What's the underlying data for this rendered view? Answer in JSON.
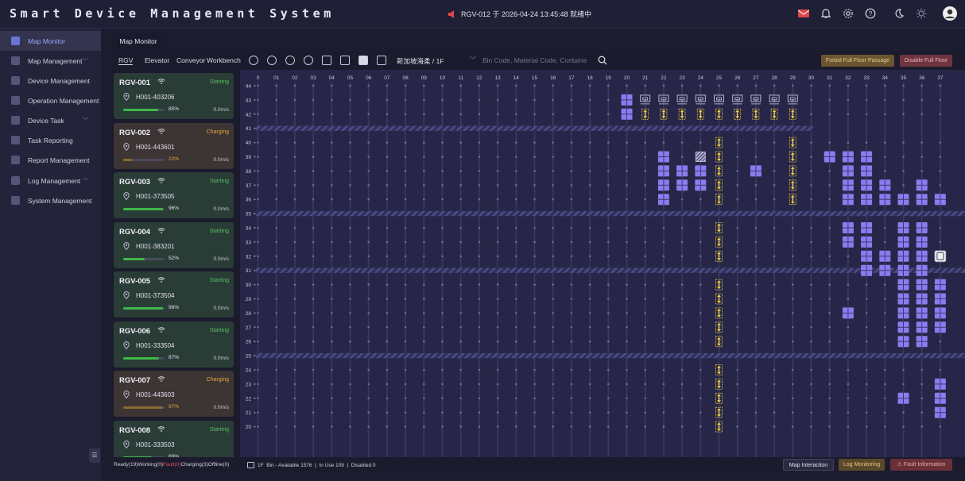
{
  "app": {
    "title": "Smart Device Management System",
    "alert_text": "RGV-012 于 2026-04-24 13:45:48 就绪中",
    "top_icons": [
      "mail-icon",
      "bell-icon",
      "gear-icon",
      "help-icon",
      "moon-icon",
      "sun-icon",
      "avatar"
    ]
  },
  "sidebar": {
    "items": [
      {
        "label": "Map Monitor",
        "active": true,
        "chevron": false
      },
      {
        "label": "Map Management",
        "active": false,
        "chevron": true
      },
      {
        "label": "Device Management",
        "active": false,
        "chevron": false
      },
      {
        "label": "Operation Management",
        "active": false,
        "chevron": false
      },
      {
        "label": "Device Task",
        "active": false,
        "chevron": true
      },
      {
        "label": "Task Reporting",
        "active": false,
        "chevron": false
      },
      {
        "label": "Report Management",
        "active": false,
        "chevron": false
      },
      {
        "label": "Log Management",
        "active": false,
        "chevron": true
      },
      {
        "label": "System Management",
        "active": false,
        "chevron": false
      }
    ],
    "collapse_glyph": "☰"
  },
  "tabs": {
    "active": "Map Monitor"
  },
  "toolbar": {
    "tabs": [
      "RGV",
      "Elevator",
      "Conveyor",
      "Workbench"
    ],
    "floor": "新加坡海柔 / 1F",
    "search_placeholder": "Bin Code, Material Code, Containe",
    "forbid_label": "Forbid Full Floor Passage",
    "disable_label": "Disable Full Floor"
  },
  "devices": [
    {
      "name": "RGV-001",
      "status": "Starting",
      "code": "H001-403206",
      "battery": 85,
      "battery_label": "85%",
      "speed": "0.0m/s"
    },
    {
      "name": "RGV-002",
      "status": "Charging",
      "code": "H001-443601",
      "battery": 22,
      "battery_label": "22%",
      "speed": "0.0m/s"
    },
    {
      "name": "RGV-003",
      "status": "Starting",
      "code": "H001-373505",
      "battery": 96,
      "battery_label": "96%",
      "speed": "0.0m/s"
    },
    {
      "name": "RGV-004",
      "status": "Starting",
      "code": "H001-383201",
      "battery": 52,
      "battery_label": "52%",
      "speed": "0.0m/s"
    },
    {
      "name": "RGV-005",
      "status": "Starting",
      "code": "H001-373504",
      "battery": 96,
      "battery_label": "96%",
      "speed": "0.0m/s"
    },
    {
      "name": "RGV-006",
      "status": "Starting",
      "code": "H001-333504",
      "battery": 87,
      "battery_label": "87%",
      "speed": "0.0m/s"
    },
    {
      "name": "RGV-007",
      "status": "Charging",
      "code": "H001-443603",
      "battery": 97,
      "battery_label": "97%",
      "speed": "0.0m/s"
    },
    {
      "name": "RGV-008",
      "status": "Starting",
      "code": "H001-333503",
      "battery": 69,
      "battery_label": "69%",
      "speed": ""
    }
  ],
  "map": {
    "col_labels": [
      "0",
      "01",
      "02",
      "03",
      "04",
      "05",
      "06",
      "07",
      "08",
      "09",
      "10",
      "11",
      "12",
      "13",
      "14",
      "15",
      "16",
      "17",
      "18",
      "19",
      "20",
      "21",
      "22",
      "23",
      "24",
      "25",
      "26",
      "27",
      "28",
      "29",
      "30",
      "31",
      "32",
      "33",
      "34",
      "35",
      "36",
      "37"
    ],
    "row_labels": [
      "44",
      "43",
      "42",
      "41",
      "40",
      "39",
      "38",
      "37",
      "36",
      "35",
      "34",
      "33",
      "32",
      "31",
      "30",
      "29",
      "28",
      "27",
      "26",
      "25",
      "24",
      "23",
      "22",
      "21",
      "20"
    ],
    "aisle_rows": [
      "41",
      "35",
      "31",
      "25"
    ],
    "aisle_extent_cols": [
      "0",
      "30"
    ],
    "bins": [
      [
        "20",
        "43"
      ],
      [
        "20",
        "42"
      ],
      [
        "22",
        "39"
      ],
      [
        "22",
        "38"
      ],
      [
        "22",
        "37"
      ],
      [
        "22",
        "36"
      ],
      [
        "23",
        "38"
      ],
      [
        "23",
        "37"
      ],
      [
        "24",
        "38"
      ],
      [
        "24",
        "37"
      ],
      [
        "27",
        "38"
      ],
      [
        "31",
        "39"
      ],
      [
        "32",
        "39"
      ],
      [
        "32",
        "38"
      ],
      [
        "32",
        "37"
      ],
      [
        "32",
        "36"
      ],
      [
        "32",
        "34"
      ],
      [
        "32",
        "33"
      ],
      [
        "32",
        "28"
      ],
      [
        "33",
        "39"
      ],
      [
        "33",
        "38"
      ],
      [
        "33",
        "37"
      ],
      [
        "33",
        "36"
      ],
      [
        "33",
        "34"
      ],
      [
        "33",
        "33"
      ],
      [
        "33",
        "32"
      ],
      [
        "33",
        "31"
      ],
      [
        "34",
        "37"
      ],
      [
        "34",
        "36"
      ],
      [
        "34",
        "32"
      ],
      [
        "34",
        "31"
      ],
      [
        "35",
        "36"
      ],
      [
        "35",
        "34"
      ],
      [
        "35",
        "33"
      ],
      [
        "35",
        "32"
      ],
      [
        "35",
        "31"
      ],
      [
        "35",
        "30"
      ],
      [
        "35",
        "29"
      ],
      [
        "35",
        "28"
      ],
      [
        "35",
        "27"
      ],
      [
        "35",
        "26"
      ],
      [
        "35",
        "22"
      ],
      [
        "36",
        "37"
      ],
      [
        "36",
        "36"
      ],
      [
        "36",
        "34"
      ],
      [
        "36",
        "33"
      ],
      [
        "36",
        "32"
      ],
      [
        "36",
        "31"
      ],
      [
        "36",
        "30"
      ],
      [
        "36",
        "29"
      ],
      [
        "36",
        "28"
      ],
      [
        "36",
        "27"
      ],
      [
        "36",
        "26"
      ],
      [
        "37",
        "36"
      ],
      [
        "37",
        "30"
      ],
      [
        "37",
        "29"
      ],
      [
        "37",
        "28"
      ],
      [
        "37",
        "27"
      ],
      [
        "37",
        "23"
      ],
      [
        "37",
        "22"
      ],
      [
        "37",
        "21"
      ]
    ],
    "hatched_bins": [
      [
        "24",
        "39"
      ]
    ],
    "lifts": [
      [
        "21",
        "42"
      ],
      [
        "22",
        "42"
      ],
      [
        "23",
        "42"
      ],
      [
        "24",
        "42"
      ],
      [
        "25",
        "42"
      ],
      [
        "26",
        "42"
      ],
      [
        "27",
        "42"
      ],
      [
        "28",
        "42"
      ],
      [
        "29",
        "42"
      ],
      [
        "25",
        "40"
      ],
      [
        "25",
        "39"
      ],
      [
        "25",
        "38"
      ],
      [
        "25",
        "37"
      ],
      [
        "25",
        "36"
      ],
      [
        "25",
        "34"
      ],
      [
        "25",
        "33"
      ],
      [
        "25",
        "32"
      ],
      [
        "25",
        "30"
      ],
      [
        "25",
        "29"
      ],
      [
        "25",
        "28"
      ],
      [
        "25",
        "27"
      ],
      [
        "25",
        "26"
      ],
      [
        "25",
        "24"
      ],
      [
        "25",
        "23"
      ],
      [
        "25",
        "22"
      ],
      [
        "25",
        "21"
      ],
      [
        "25",
        "20"
      ],
      [
        "29",
        "40"
      ],
      [
        "29",
        "39"
      ],
      [
        "29",
        "38"
      ],
      [
        "29",
        "37"
      ],
      [
        "29",
        "36"
      ]
    ],
    "stations": [
      "21",
      "22",
      "23",
      "24",
      "25",
      "26",
      "27",
      "28",
      "29"
    ],
    "device_marker": [
      "37",
      "32"
    ],
    "colors": {
      "bin": "#8a7cf0",
      "lift": "#f0d040",
      "grid": "#3a3a60",
      "aisle": "#4c4c88",
      "background": "#272648"
    }
  },
  "statusbar": {
    "counts": {
      "ready": "Ready(19)",
      "working": "Working(0)",
      "fault": "Fault(0)",
      "charging": "Charging(3)",
      "offline": "Offline(0)"
    },
    "bin_info": "1F  Bin - Available 1576  |  In Use 109  |  Disabled 0",
    "map_interaction": "Map Interaction",
    "log_monitoring": "Log Monitoring",
    "fault_information": "⚠ Fault Information"
  }
}
